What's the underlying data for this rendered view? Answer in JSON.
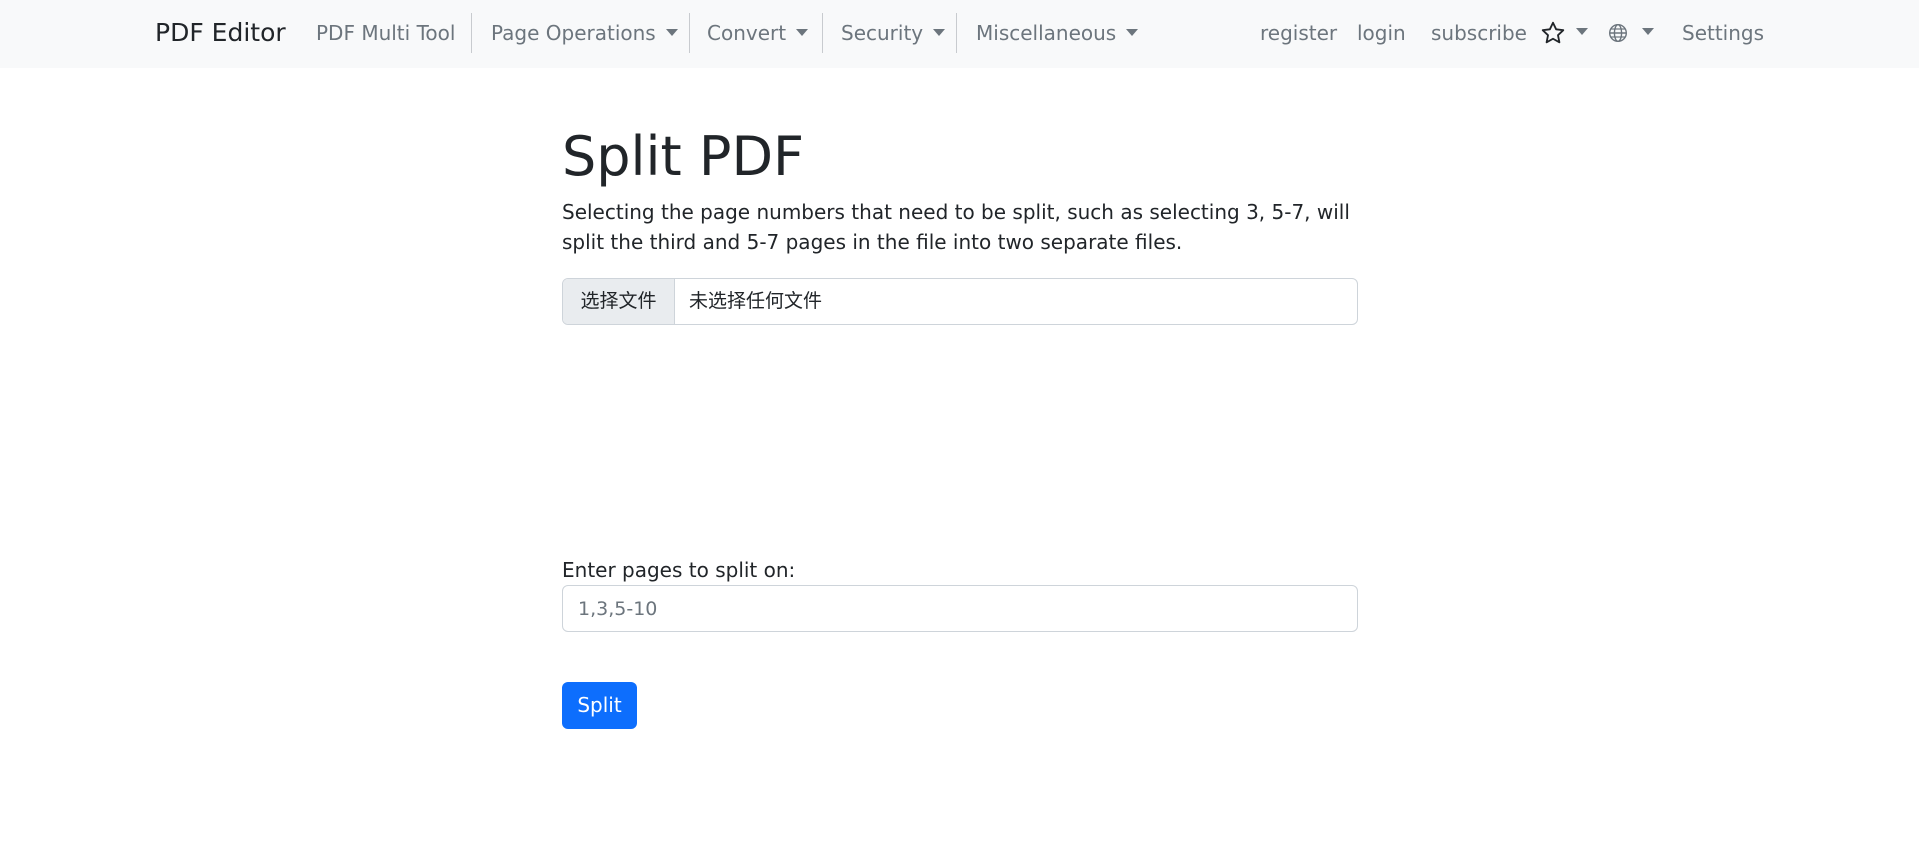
{
  "navbar": {
    "brand": "PDF Editor",
    "items": [
      {
        "label": "PDF Multi Tool"
      },
      {
        "label": "Page Operations"
      },
      {
        "label": "Convert"
      },
      {
        "label": "Security"
      },
      {
        "label": "Miscellaneous"
      }
    ],
    "right": {
      "register": "register",
      "login": "login",
      "subscribe": "subscribe",
      "favorites_icon": "star-icon",
      "language_icon": "globe-icon",
      "settings": "Settings"
    }
  },
  "main": {
    "title": "Split PDF",
    "description": "Selecting the page numbers that need to be split, such as selecting 3, 5-7, will split the third and 5-7 pages in the file into two separate files.",
    "file_input": {
      "button_label": "选择文件",
      "status": "未选择任何文件"
    },
    "pages_label": "Enter pages to split on:",
    "pages_input": {
      "value": "",
      "placeholder": "1,3,5-10"
    },
    "submit_label": "Split"
  },
  "colors": {
    "navbar_bg": "#f8f9fa",
    "primary": "#0d6efd",
    "muted_text": "#6c757d"
  }
}
